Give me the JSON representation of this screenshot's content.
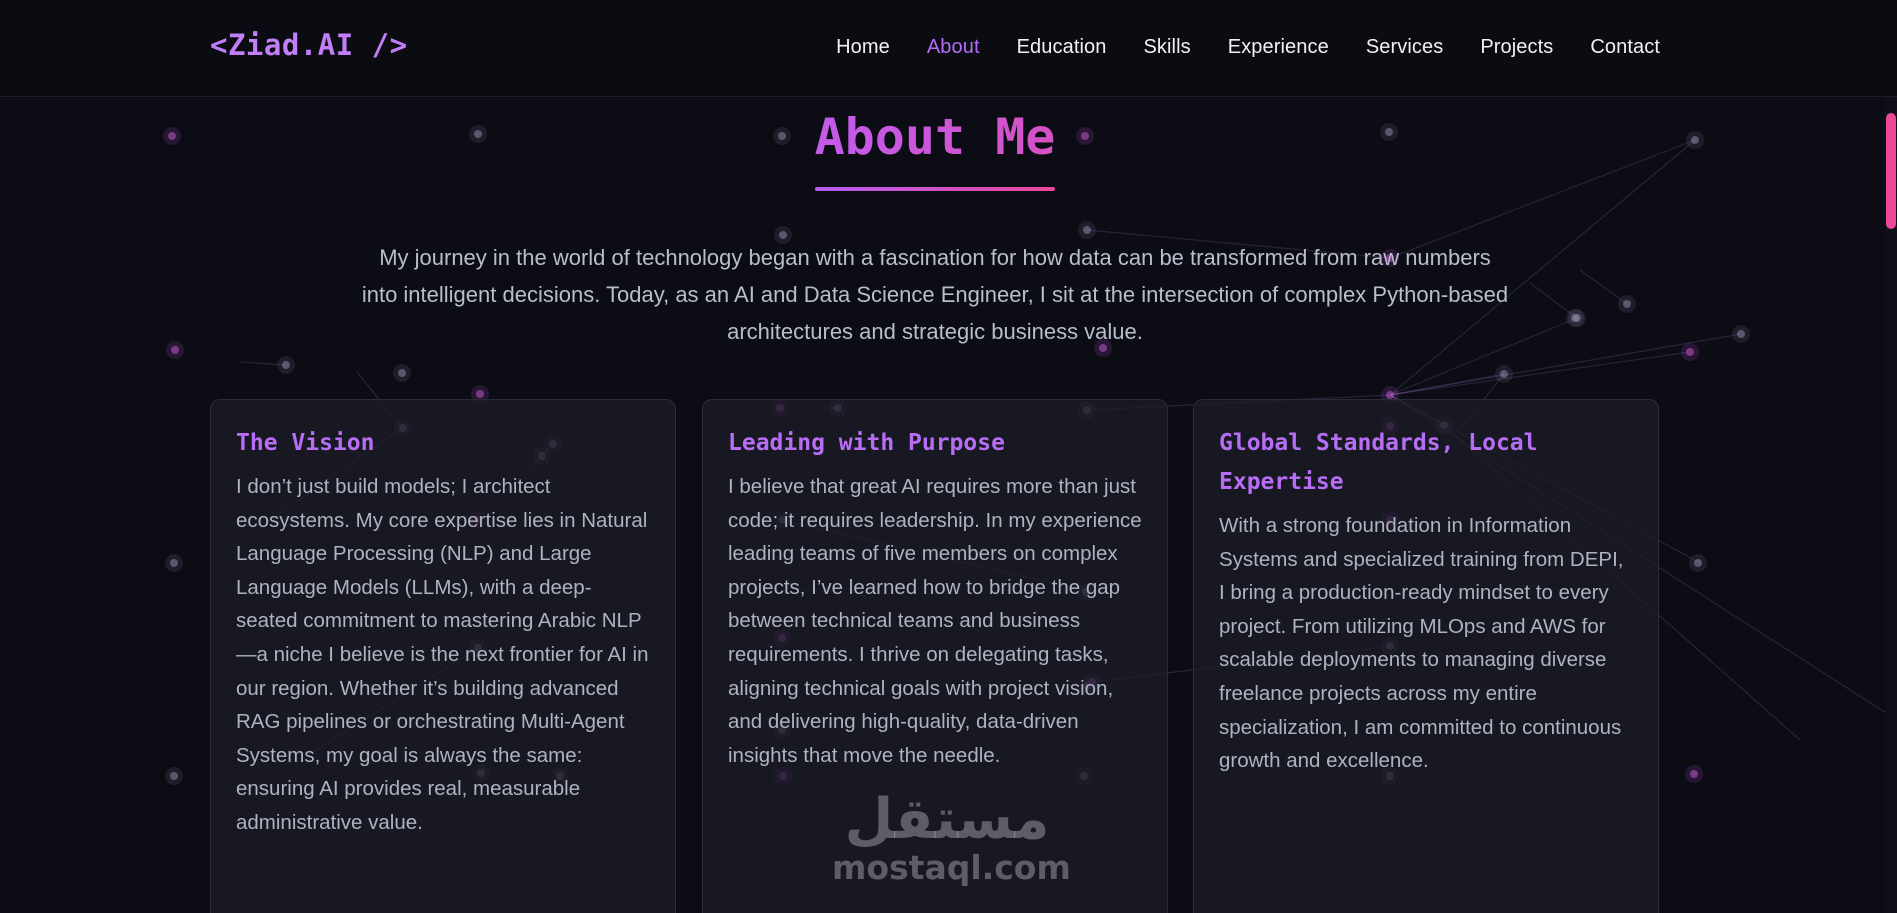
{
  "brand": {
    "logo": "<Ziad.AI />"
  },
  "nav": {
    "items": [
      {
        "label": "Home",
        "active": false
      },
      {
        "label": "About",
        "active": true
      },
      {
        "label": "Education",
        "active": false
      },
      {
        "label": "Skills",
        "active": false
      },
      {
        "label": "Experience",
        "active": false
      },
      {
        "label": "Services",
        "active": false
      },
      {
        "label": "Projects",
        "active": false
      },
      {
        "label": "Contact",
        "active": false
      }
    ]
  },
  "about": {
    "title": "About Me",
    "intro": "My journey in the world of technology began with a fascination for how data can be transformed from raw numbers into intelligent decisions. Today, as an AI and Data Science Engineer, I sit at the intersection of complex Python-based architectures and strategic business value.",
    "cards": [
      {
        "title": "The Vision",
        "text": "I don’t just build models; I architect ecosystems. My core expertise lies in Natural Language Processing (NLP) and Large Language Models (LLMs), with a deep-seated commitment to mastering Arabic NLP—a niche I believe is the next frontier for AI in our region. Whether it’s building advanced RAG pipelines or orchestrating Multi-Agent Systems, my goal is always the same: ensuring AI provides real, measurable administrative value."
      },
      {
        "title": "Leading with Purpose",
        "text": "I believe that great AI requires more than just code; it requires leadership. In my experience leading teams of five members on complex projects, I’ve learned how to bridge the gap between technical teams and business requirements. I thrive on delegating tasks, aligning technical goals with project vision, and delivering high-quality, data-driven insights that move the needle."
      },
      {
        "title": "Global Standards, Local Expertise",
        "text": "With a strong foundation in Information Systems and specialized training from DEPI, I bring a production-ready mindset to every project. From utilizing MLOps and AWS for scalable deployments to managing diverse freelance projects across my entire specialization, I am committed to continuous growth and excellence."
      }
    ]
  },
  "watermark": {
    "arabic": "مستقل",
    "latin": "mostaql.com"
  },
  "colors": {
    "accent_purple": "#b56cf5",
    "accent_pink": "#ec4899",
    "background": "#0b0c14"
  }
}
